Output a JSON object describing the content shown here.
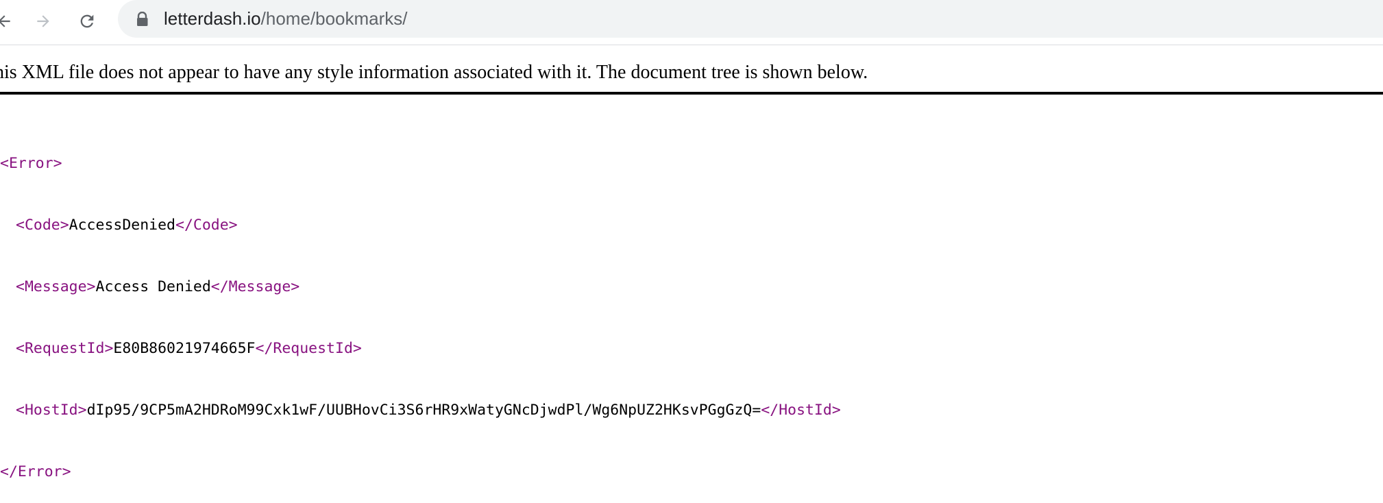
{
  "browser": {
    "url_domain": "letterdash.io",
    "url_path": "/home/bookmarks/",
    "icons": {
      "back": "arrow-left-icon",
      "forward": "arrow-right-icon",
      "reload": "reload-icon",
      "lock": "lock-icon"
    }
  },
  "xml_notice": "his XML file does not appear to have any style information associated with it. The document tree is shown below.",
  "xml_tree": {
    "root_open": "<Error>",
    "root_close": "</Error>",
    "code": {
      "open": "<Code>",
      "value": "AccessDenied",
      "close": "</Code>"
    },
    "message": {
      "open": "<Message>",
      "value": "Access Denied",
      "close": "</Message>"
    },
    "request_id": {
      "open": "<RequestId>",
      "value": "E80B86021974665F",
      "close": "</RequestId>"
    },
    "host_id": {
      "open": "<HostId>",
      "value": "dIp95/9CP5mA2HDRoM99Cxk1wF/UUBHovCi3S6rHR9xWatyGNcDjwdPl/Wg6NpUZ2HKsvPGgGzQ=",
      "close": "</HostId>"
    }
  },
  "colors": {
    "tag": "#881280",
    "omnibox_bg": "#f1f3f4"
  }
}
